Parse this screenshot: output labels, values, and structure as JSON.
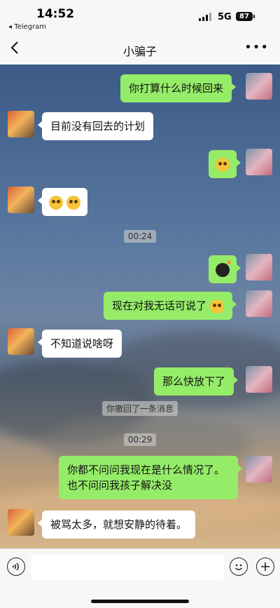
{
  "status": {
    "time": "14:52",
    "back_app": "◂ Telegram",
    "network": "5G",
    "battery": "87"
  },
  "nav": {
    "title": "小骗子",
    "more": "•••",
    "back_icon": "chevron-left-icon"
  },
  "messages": [
    {
      "dir": "out",
      "text": "你打算什么时候回来"
    },
    {
      "dir": "in",
      "text": "目前没有回去的计划"
    },
    {
      "dir": "out",
      "emoji": [
        "smirk-face-emoji"
      ]
    },
    {
      "dir": "in",
      "emoji": [
        "flushed-face-emoji",
        "flushed-face-emoji"
      ]
    },
    {
      "timestamp": "00:24"
    },
    {
      "dir": "out",
      "emoji": [
        "bomb-emoji"
      ]
    },
    {
      "dir": "out",
      "text": "现在对我无话可说了",
      "emoji": [
        "smirk-face-emoji"
      ]
    },
    {
      "dir": "in",
      "text": "不知道说啥呀"
    },
    {
      "dir": "out",
      "text": "那么快放下了"
    },
    {
      "system": "你撤回了一条消息"
    },
    {
      "timestamp": "00:29"
    },
    {
      "dir": "out",
      "text": "你都不问问我现在是什么情况了。",
      "text2": "也不问问我孩子解决没"
    },
    {
      "dir": "in",
      "text": "被骂太多，就想安静的待着。"
    }
  ],
  "input": {
    "placeholder": "",
    "voice_icon": "voice-icon",
    "emoji_icon": "emoji-icon",
    "plus_icon": "plus-icon"
  },
  "colors": {
    "out_bubble": "#95ec69",
    "in_bubble": "#ffffff"
  }
}
